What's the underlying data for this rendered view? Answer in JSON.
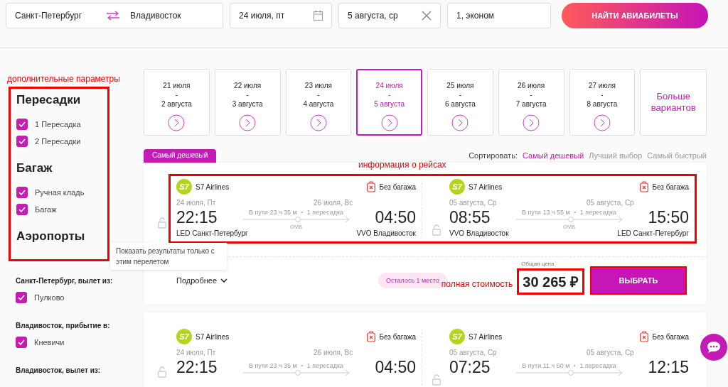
{
  "search": {
    "from": "Санкт-Петербург",
    "to": "Владивосток",
    "depart": "24 июля, пт",
    "return": "5 августа, ср",
    "passengers": "1, эконом",
    "button": "НАЙТИ АВИАБИЛЕТЫ"
  },
  "filters": {
    "note": "дополнительные параметры",
    "highlighted": true,
    "groups": [
      {
        "title": "Пересадки",
        "options": [
          {
            "label": "1 Пересадка",
            "checked": true
          },
          {
            "label": "2 Пересадки",
            "checked": true
          }
        ]
      },
      {
        "title": "Багаж",
        "options": [
          {
            "label": "Ручная кладь",
            "checked": true
          },
          {
            "label": "Багаж",
            "checked": true
          }
        ]
      },
      {
        "title": "Аэропорты"
      }
    ]
  },
  "airport_filters": [
    {
      "title": "Санкт-Петербург, вылет из:",
      "options": [
        {
          "label": "Пулково",
          "checked": true
        }
      ]
    },
    {
      "title": "Владивосток, прибытие в:",
      "options": [
        {
          "label": "Кневичи",
          "checked": true
        }
      ]
    },
    {
      "title": "Владивосток, вылет из:"
    }
  ],
  "dates": [
    {
      "outbound": "21 июля",
      "sep": "-",
      "return": "2 августа",
      "selected": false
    },
    {
      "outbound": "22 июля",
      "sep": "-",
      "return": "3 августа",
      "selected": false
    },
    {
      "outbound": "23 июля",
      "sep": "-",
      "return": "4 августа",
      "selected": false
    },
    {
      "outbound": "24 июля",
      "sep": "-",
      "return": "5 августа",
      "selected": true
    },
    {
      "outbound": "25 июля",
      "sep": "-",
      "return": "6 августа",
      "selected": false
    },
    {
      "outbound": "26 июля",
      "sep": "-",
      "return": "7 августа",
      "selected": false
    },
    {
      "outbound": "27 июля",
      "sep": "-",
      "return": "8 августа",
      "selected": false
    }
  ],
  "more_dates": "Больше вариантов",
  "sort": {
    "label": "Сортировать:",
    "options": [
      {
        "label": "Самый дешевый",
        "selected": true
      },
      {
        "label": "Лучший выбор",
        "selected": false
      },
      {
        "label": "Самый быстрый",
        "selected": false
      }
    ]
  },
  "results": [
    {
      "tag": "Самый дешевый",
      "note": "информация о рейсах",
      "highlighted": true,
      "segments": [
        {
          "logo": "S7",
          "airline": "S7 Airlines",
          "baggage": "Без багажа",
          "dep_date": "24 июля, Пт",
          "dep_time": "22:15",
          "dep_airport": "LED Санкт-Петербург",
          "duration": "В пути 23 ч 35 м",
          "stops": "1 пересадка",
          "via": "OVB",
          "arr_date": "26 июля, Вс",
          "arr_time": "04:50",
          "arr_airport": "VVO Владивосток"
        },
        {
          "logo": "S7",
          "airline": "S7 Airlines",
          "baggage": "Без багажа",
          "dep_date": "05 августа, Ср",
          "dep_time": "08:55",
          "dep_airport": "VVO Владивосток",
          "duration": "В пути 13 ч 55 м",
          "stops": "1 пересадка",
          "via": "OVB",
          "arr_date": "05 августа, Ср",
          "arr_time": "15:50",
          "arr_airport": "LED Санкт-Петербург"
        }
      ],
      "tooltip": "Показать результаты только с этим перелетом",
      "details": "Подробнее",
      "seats_left": "Осталось 1 место",
      "price_note": "полная стоимость",
      "price_label": "Общая цена",
      "price": "30 265 ₽",
      "price_highlighted": true,
      "select": "ВЫБРАТЬ",
      "select_highlighted": true
    },
    {
      "highlighted": false,
      "segments": [
        {
          "logo": "S7",
          "airline": "S7 Airlines",
          "baggage": "Без багажа",
          "dep_date": "24 июля, Пт",
          "dep_time": "22:15",
          "duration": "В пути 23 ч 35 м",
          "stops": "1 пересадка",
          "arr_date": "26 июля, Вс",
          "arr_time": "04:50"
        },
        {
          "logo": "S7",
          "airline": "S7 Airlines",
          "baggage": "Без багажа",
          "dep_date": "05 августа, Ср",
          "dep_time": "07:25",
          "duration": "В пути 11 ч 50 м",
          "stops": "1 пересадка",
          "arr_date": "05 августа, Ср",
          "arr_time": "12:15"
        }
      ]
    }
  ]
}
